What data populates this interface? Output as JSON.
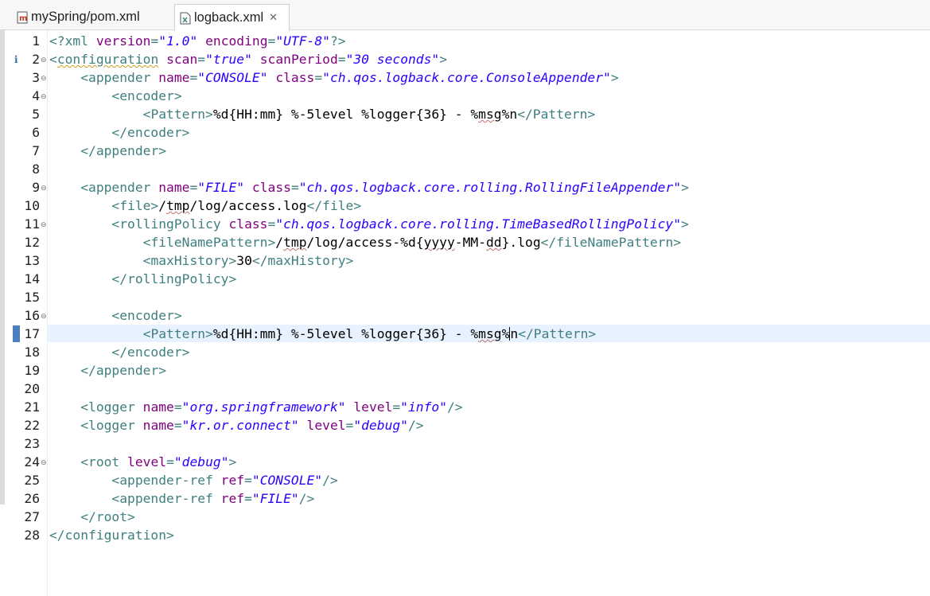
{
  "tabs": [
    {
      "label": "mySpring/pom.xml",
      "active": false,
      "icon": "maven-file-icon"
    },
    {
      "label": "logback.xml",
      "active": true,
      "icon": "xml-file-icon",
      "close_glyph": "✕"
    }
  ],
  "editor": {
    "language": "xml",
    "current_line": 17,
    "info_marker_line": 2,
    "info_glyph": "i",
    "fold_glyph": "⊖",
    "colors": {
      "tag": "#3f7f7f",
      "attribute_name": "#7f007f",
      "attribute_value": "#2a00ff",
      "text": "#000000",
      "current_line_bg": "#e8f2fe"
    },
    "lines": [
      {
        "n": "1",
        "fold": false,
        "t": [
          "<?",
          "xml",
          " "
        ],
        "a": [
          "version",
          "="
        ],
        "v": [
          "\"1.0\""
        ],
        "b": [
          " "
        ],
        "a2": [
          "encoding",
          "="
        ],
        "v2": [
          "\"UTF-8\""
        ],
        "e": [
          "?>"
        ]
      },
      {
        "n": "2"
      },
      {
        "n": "3"
      },
      {
        "n": "4"
      },
      {
        "n": "5"
      },
      {
        "n": "6"
      },
      {
        "n": "7"
      },
      {
        "n": "8"
      },
      {
        "n": "9"
      },
      {
        "n": "10"
      },
      {
        "n": "11"
      },
      {
        "n": "12"
      },
      {
        "n": "13"
      },
      {
        "n": "14"
      },
      {
        "n": "15"
      },
      {
        "n": "16"
      },
      {
        "n": "17"
      },
      {
        "n": "18"
      },
      {
        "n": "19"
      },
      {
        "n": "20"
      },
      {
        "n": "21"
      },
      {
        "n": "22"
      },
      {
        "n": "23"
      },
      {
        "n": "24"
      },
      {
        "n": "25"
      },
      {
        "n": "26"
      },
      {
        "n": "27"
      },
      {
        "n": "28"
      }
    ],
    "code_segments": {
      "l1": [
        [
          "t",
          "<?xml "
        ],
        [
          "an",
          "version"
        ],
        [
          "t",
          "="
        ],
        [
          "av",
          "\"1.0\""
        ],
        [
          "tx",
          " "
        ],
        [
          "an",
          "encoding"
        ],
        [
          "t",
          "="
        ],
        [
          "av",
          "\"UTF-8\""
        ],
        [
          "t",
          "?>"
        ]
      ],
      "l2": [
        [
          "t",
          "<"
        ],
        [
          "tsq",
          "configuration"
        ],
        [
          "tx",
          " "
        ],
        [
          "an",
          "scan"
        ],
        [
          "t",
          "="
        ],
        [
          "av",
          "\"true\""
        ],
        [
          "tx",
          " "
        ],
        [
          "an",
          "scanPeriod"
        ],
        [
          "t",
          "="
        ],
        [
          "av",
          "\"30 seconds\""
        ],
        [
          "t",
          ">"
        ]
      ],
      "l3": [
        [
          "tx",
          "    "
        ],
        [
          "t",
          "<appender "
        ],
        [
          "an",
          "name"
        ],
        [
          "t",
          "="
        ],
        [
          "av",
          "\"CONSOLE\""
        ],
        [
          "tx",
          " "
        ],
        [
          "an",
          "class"
        ],
        [
          "t",
          "="
        ],
        [
          "av",
          "\"ch.qos.logback.core.ConsoleAppender\""
        ],
        [
          "t",
          ">"
        ]
      ],
      "l4": [
        [
          "tx",
          "        "
        ],
        [
          "t",
          "<encoder>"
        ]
      ],
      "l5": [
        [
          "tx",
          "            "
        ],
        [
          "t",
          "<Pattern>"
        ],
        [
          "tx",
          "%d{HH:mm} %-5level %logger{36} - %"
        ],
        [
          "txsq",
          "msg"
        ],
        [
          "tx",
          "%n"
        ],
        [
          "t",
          "</Pattern>"
        ]
      ],
      "l6": [
        [
          "tx",
          "        "
        ],
        [
          "t",
          "</encoder>"
        ]
      ],
      "l7": [
        [
          "tx",
          "    "
        ],
        [
          "t",
          "</appender>"
        ]
      ],
      "l8": [],
      "l9": [
        [
          "tx",
          "    "
        ],
        [
          "t",
          "<appender "
        ],
        [
          "an",
          "name"
        ],
        [
          "t",
          "="
        ],
        [
          "av",
          "\"FILE\""
        ],
        [
          "tx",
          " "
        ],
        [
          "an",
          "class"
        ],
        [
          "t",
          "="
        ],
        [
          "av",
          "\"ch.qos.logback.core.rolling.RollingFileAppender\""
        ],
        [
          "t",
          ">"
        ]
      ],
      "l10": [
        [
          "tx",
          "        "
        ],
        [
          "t",
          "<file>"
        ],
        [
          "tx",
          "/"
        ],
        [
          "txsq",
          "tmp"
        ],
        [
          "tx",
          "/log/access.log"
        ],
        [
          "t",
          "</file>"
        ]
      ],
      "l11": [
        [
          "tx",
          "        "
        ],
        [
          "t",
          "<rollingPolicy "
        ],
        [
          "an",
          "class"
        ],
        [
          "t",
          "="
        ],
        [
          "av",
          "\"ch.qos.logback.core.rolling.TimeBasedRollingPolicy\""
        ],
        [
          "t",
          ">"
        ]
      ],
      "l12": [
        [
          "tx",
          "            "
        ],
        [
          "t",
          "<fileNamePattern>"
        ],
        [
          "tx",
          "/"
        ],
        [
          "txsq",
          "tmp"
        ],
        [
          "tx",
          "/log/access-%d{"
        ],
        [
          "txsq",
          "yyyy"
        ],
        [
          "tx",
          "-MM-"
        ],
        [
          "txsq",
          "dd"
        ],
        [
          "tx",
          "}.log"
        ],
        [
          "t",
          "</fileNamePattern>"
        ]
      ],
      "l13": [
        [
          "tx",
          "            "
        ],
        [
          "t",
          "<maxHistory>"
        ],
        [
          "tx",
          "30"
        ],
        [
          "t",
          "</maxHistory>"
        ]
      ],
      "l14": [
        [
          "tx",
          "        "
        ],
        [
          "t",
          "</rollingPolicy>"
        ]
      ],
      "l15": [],
      "l16": [
        [
          "tx",
          "        "
        ],
        [
          "t",
          "<encoder>"
        ]
      ],
      "l17": [
        [
          "tx",
          "            "
        ],
        [
          "t",
          "<Pattern>"
        ],
        [
          "tx",
          "%d{HH:mm} %-5level %logger{36} - %"
        ],
        [
          "txsq",
          "msg"
        ],
        [
          "tx",
          "%"
        ],
        [
          "caret",
          ""
        ],
        [
          "tx",
          "n"
        ],
        [
          "t",
          "</Pattern>"
        ]
      ],
      "l18": [
        [
          "tx",
          "        "
        ],
        [
          "t",
          "</encoder>"
        ]
      ],
      "l19": [
        [
          "tx",
          "    "
        ],
        [
          "t",
          "</appender>"
        ]
      ],
      "l20": [],
      "l21": [
        [
          "tx",
          "    "
        ],
        [
          "t",
          "<logger "
        ],
        [
          "an",
          "name"
        ],
        [
          "t",
          "="
        ],
        [
          "av",
          "\"org.springframework\""
        ],
        [
          "tx",
          " "
        ],
        [
          "an",
          "level"
        ],
        [
          "t",
          "="
        ],
        [
          "av",
          "\"info\""
        ],
        [
          "t",
          "/>"
        ]
      ],
      "l22": [
        [
          "tx",
          "    "
        ],
        [
          "t",
          "<logger "
        ],
        [
          "an",
          "name"
        ],
        [
          "t",
          "="
        ],
        [
          "av",
          "\"kr.or.connect\""
        ],
        [
          "tx",
          " "
        ],
        [
          "an",
          "level"
        ],
        [
          "t",
          "="
        ],
        [
          "av",
          "\"debug\""
        ],
        [
          "t",
          "/>"
        ]
      ],
      "l23": [],
      "l24": [
        [
          "tx",
          "    "
        ],
        [
          "t",
          "<root "
        ],
        [
          "an",
          "level"
        ],
        [
          "t",
          "="
        ],
        [
          "av",
          "\"debug\""
        ],
        [
          "t",
          ">"
        ]
      ],
      "l25": [
        [
          "tx",
          "        "
        ],
        [
          "t",
          "<appender-ref "
        ],
        [
          "an",
          "ref"
        ],
        [
          "t",
          "="
        ],
        [
          "av",
          "\"CONSOLE\""
        ],
        [
          "t",
          "/>"
        ]
      ],
      "l26": [
        [
          "tx",
          "        "
        ],
        [
          "t",
          "<appender-ref "
        ],
        [
          "an",
          "ref"
        ],
        [
          "t",
          "="
        ],
        [
          "av",
          "\"FILE\""
        ],
        [
          "t",
          "/>"
        ]
      ],
      "l27": [
        [
          "tx",
          "    "
        ],
        [
          "t",
          "</root>"
        ]
      ],
      "l28": [
        [
          "t",
          "</configuration>"
        ]
      ]
    },
    "foldable_lines": [
      "2",
      "3",
      "4",
      "9",
      "11",
      "16",
      "24"
    ]
  }
}
